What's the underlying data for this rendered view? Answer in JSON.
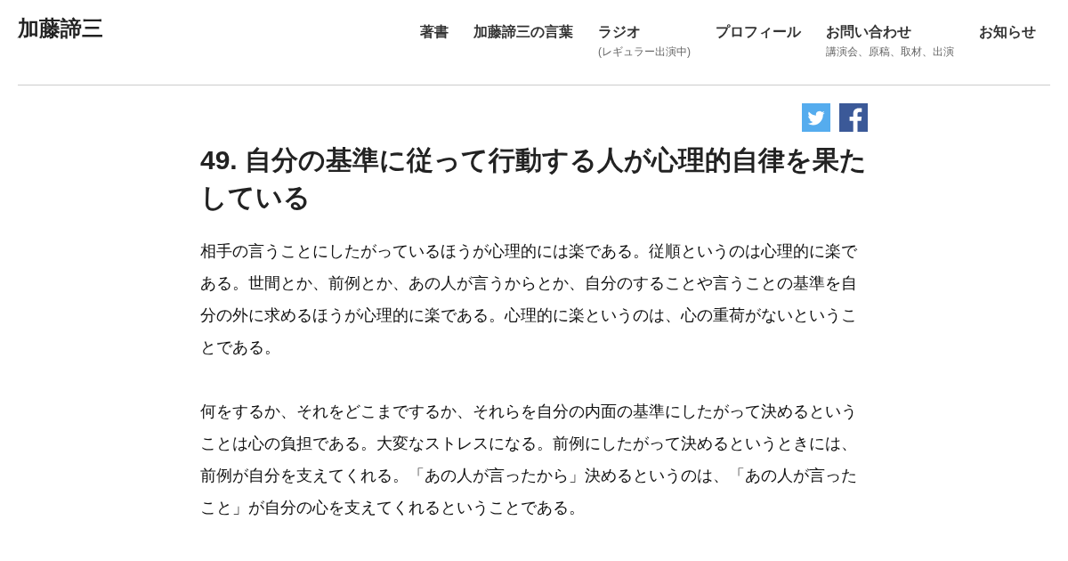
{
  "site_title": "加藤諦三",
  "nav": [
    {
      "label": "著書"
    },
    {
      "label": "加藤諦三の言葉"
    },
    {
      "label": "ラジオ",
      "sub": "(レギュラー出演中)"
    },
    {
      "label": "プロフィール"
    },
    {
      "label": "お問い合わせ",
      "sub": "講演会、原稿、取材、出演"
    },
    {
      "label": "お知らせ"
    }
  ],
  "share": [
    {
      "kind": "twitter"
    },
    {
      "kind": "facebook"
    }
  ],
  "article": {
    "title": "49. 自分の基準に従って行動する人が心理的自律を果たしている",
    "paragraphs": [
      "相手の言うことにしたがっているほうが心理的には楽である。従順というのは心理的に楽である。世間とか、前例とか、あの人が言うからとか、自分のすることや言うことの基準を自分の外に求めるほうが心理的に楽である。心理的に楽というのは、心の重荷がないということである。",
      "何をするか、それをどこまでするか、それらを自分の内面の基準にしたがって決めるということは心の負担である。大変なストレスになる。前例にしたがって決めるというときには、前例が自分を支えてくれる。「あの人が言ったから」決めるというのは、「あの人が言ったこと」が自分の心を支えてくれるということである。"
    ]
  }
}
